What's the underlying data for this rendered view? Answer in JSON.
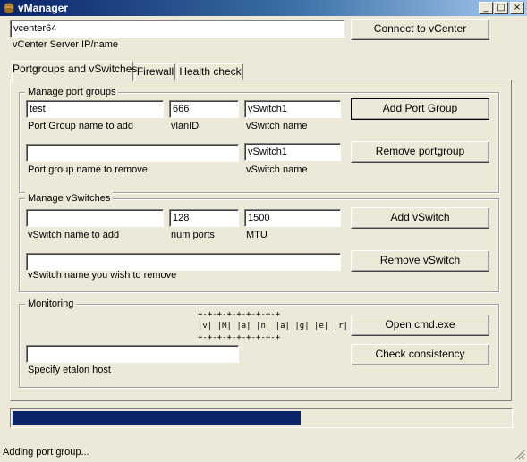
{
  "window": {
    "title": "vManager"
  },
  "titlebar_buttons": {
    "minimize": "_",
    "maximize": "□",
    "close": "×"
  },
  "connection": {
    "server_value": "vcenter64",
    "server_label": "vCenter Server IP/name",
    "connect_button": "Connect to vCenter"
  },
  "tabs": [
    {
      "label": "Portgroups and vSwitches",
      "active": true
    },
    {
      "label": "Firewall",
      "active": false
    },
    {
      "label": "Health check",
      "active": false
    }
  ],
  "port_groups": {
    "legend": "Manage port groups",
    "add_name_value": "test",
    "add_name_label": "Port Group name to add",
    "vlan_value": "666",
    "vlan_label": "vlanID",
    "add_vswitch_value": "vSwitch1",
    "add_vswitch_label": "vSwitch name",
    "add_button": "Add Port Group",
    "remove_name_value": "",
    "remove_name_label": "Port group name to remove",
    "remove_vswitch_value": "vSwitch1",
    "remove_vswitch_label": "vSwitch name",
    "remove_button": "Remove portgroup"
  },
  "vswitches": {
    "legend": "Manage vSwitches",
    "add_name_value": "",
    "add_name_label": "vSwitch name to add",
    "ports_value": "128",
    "ports_label": "num ports",
    "mtu_value": "1500",
    "mtu_label": "MTU",
    "add_button": "Add vSwitch",
    "remove_name_value": "",
    "remove_name_label": "vSwitch name you wish to remove",
    "remove_button": "Remove vSwitch"
  },
  "monitoring": {
    "legend": "Monitoring",
    "banner_top": "+-+-+-+-+-+-+-+-+",
    "banner_mid": "|v| |M| |a| |n| |a| |g| |e| |r|",
    "banner_bottom": "+-+-+-+-+-+-+-+-+",
    "host_value": "",
    "host_label": "Specify etalon host",
    "cmd_button": "Open cmd.exe",
    "check_button": "Check consistency"
  },
  "progress": {
    "value": 0.58
  },
  "status": {
    "text": "Adding port group..."
  }
}
